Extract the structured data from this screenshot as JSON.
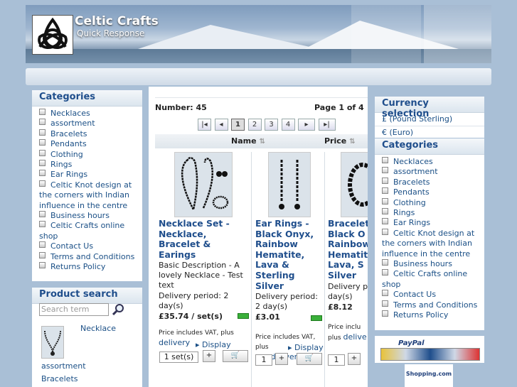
{
  "site": {
    "title": "Celtic Crafts",
    "subtitle": "Quick Response"
  },
  "left_categories": {
    "heading": "Categories",
    "items": [
      "Necklaces",
      "assortment",
      "Bracelets",
      "Pendants",
      "Clothing",
      "Rings",
      "Ear Rings",
      "Celtic Knot design at the corners with Indian influence in the centre",
      "Business hours",
      "Celtic Crafts online shop",
      "Contact Us",
      "Terms and Conditions",
      "Returns Policy"
    ]
  },
  "product_search": {
    "heading": "Product search",
    "placeholder": "Search term",
    "result_link": "Necklace",
    "result_category": "assortment",
    "next_item": "Bracelets"
  },
  "listing": {
    "number_label": "Number: 45",
    "page_label": "Page 1 of 4",
    "pages": [
      "1",
      "2",
      "3",
      "4"
    ],
    "sort_name": "Name",
    "sort_price": "Price"
  },
  "products": [
    {
      "name": "Necklace Set - Necklace, Bracelet & Earings",
      "description": "Basic Description - A lovely Necklace - Test text",
      "delivery": "Delivery period: 2 day(s)",
      "price": "£35.74 / set(s)",
      "vat": "Price includes VAT, plus",
      "vat_link": "delivery",
      "display": "Display",
      "qty": "1 set(s)"
    },
    {
      "name": "Ear Rings - Black Onyx, Rainbow Hematite, Lava & Sterling Silver",
      "delivery": "Delivery period: 2 day(s)",
      "price": "£3.01",
      "vat": "Price includes VAT, plus",
      "vat_link": "delivery",
      "display": "Display",
      "qty": "1"
    },
    {
      "name": "Bracelet Black O Rainbow Hematit Lava, S Silver",
      "delivery": "Delivery p day(s)",
      "price": "£8.12",
      "vat": "Price inclu",
      "vat_link": "delive",
      "qty": "1"
    }
  ],
  "currency": {
    "heading": "Currency selection",
    "options": [
      "£ (Pound Sterling)",
      "€ (Euro)"
    ]
  },
  "right_categories": {
    "heading": "Categories",
    "items": [
      "Necklaces",
      "assortment",
      "Bracelets",
      "Pendants",
      "Clothing",
      "Rings",
      "Ear Rings",
      "Celtic Knot design at the corners with Indian influence in the centre",
      "Business hours",
      "Celtic Crafts online shop",
      "Contact Us",
      "Terms and Conditions",
      "Returns Policy"
    ]
  },
  "badges": {
    "paypal": "PayPal",
    "shopping": "Shopping.com"
  },
  "icons": {
    "search": "magnifier-icon",
    "first": "first-page-icon",
    "prev": "prev-page-icon",
    "next": "next-page-icon",
    "last": "last-page-icon",
    "sort": "sort-icon",
    "cart": "cart-icon"
  },
  "colors": {
    "accent": "#1f4e8c",
    "background": "#a9bfd6",
    "stock": "#3ab03a"
  }
}
